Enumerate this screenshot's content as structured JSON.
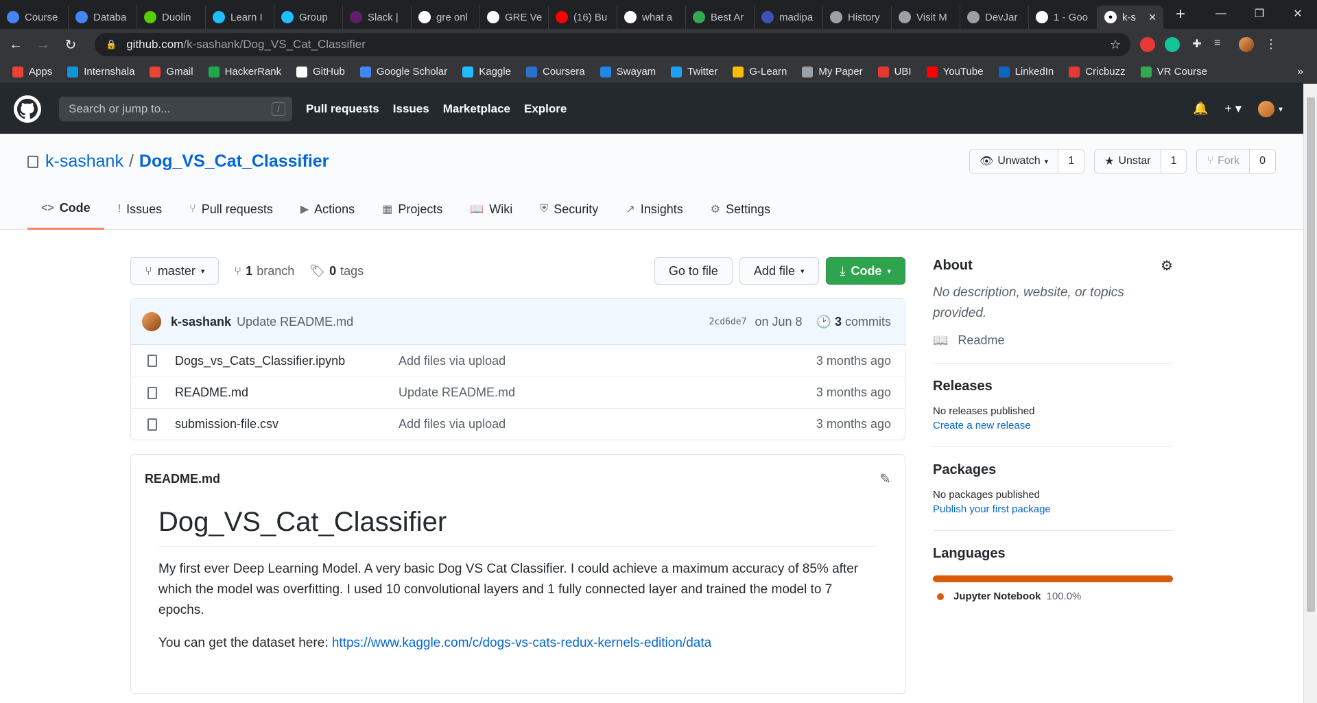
{
  "browser": {
    "tabs": [
      {
        "label": "Course",
        "icon_color": "#4285f4"
      },
      {
        "label": "Databa",
        "icon_color": "#4285f4"
      },
      {
        "label": "Duolin",
        "icon_color": "#58cc02"
      },
      {
        "label": "Learn I",
        "icon_color": "#20beff"
      },
      {
        "label": "Group",
        "icon_color": "#20beff"
      },
      {
        "label": "Slack |",
        "icon_color": "#611f69"
      },
      {
        "label": "gre onl",
        "icon_color": "#ffffff"
      },
      {
        "label": "GRE Ve",
        "icon_color": "#ffffff"
      },
      {
        "label": "(16) Bu",
        "icon_color": "#ff0000"
      },
      {
        "label": "what a",
        "icon_color": "#ffffff"
      },
      {
        "label": "Best Ar",
        "icon_color": "#34a853"
      },
      {
        "label": "madipa",
        "icon_color": "#3f51b5"
      },
      {
        "label": "History",
        "icon_color": "#9aa0a6"
      },
      {
        "label": "Visit M",
        "icon_color": "#9aa0a6"
      },
      {
        "label": "DevJar",
        "icon_color": "#9aa0a6"
      },
      {
        "label": "1 - Goo",
        "icon_color": "#ffffff"
      }
    ],
    "active_tab": {
      "label": "k-s"
    },
    "url_host": "github.com",
    "url_path": "/k-sashank/Dog_VS_Cat_Classifier",
    "bookmarks": [
      {
        "label": "Apps",
        "color": "#ea4335"
      },
      {
        "label": "Internshala",
        "color": "#1295d8"
      },
      {
        "label": "Gmail",
        "color": "#ea4335"
      },
      {
        "label": "HackerRank",
        "color": "#1ba94c"
      },
      {
        "label": "GitHub",
        "color": "#ffffff"
      },
      {
        "label": "Google Scholar",
        "color": "#4285f4"
      },
      {
        "label": "Kaggle",
        "color": "#20beff"
      },
      {
        "label": "Coursera",
        "color": "#2a73cc"
      },
      {
        "label": "Swayam",
        "color": "#1e88e5"
      },
      {
        "label": "Twitter",
        "color": "#1da1f2"
      },
      {
        "label": "G-Learn",
        "color": "#fbbc05"
      },
      {
        "label": "My Paper",
        "color": "#9aa0a6"
      },
      {
        "label": "UBI",
        "color": "#e53935"
      },
      {
        "label": "YouTube",
        "color": "#ff0000"
      },
      {
        "label": "LinkedIn",
        "color": "#0a66c2"
      },
      {
        "label": "Cricbuzz",
        "color": "#e53935"
      },
      {
        "label": "VR Course",
        "color": "#34a853"
      }
    ],
    "bookmarks_more": "»"
  },
  "gh": {
    "search_placeholder": "Search or jump to...",
    "search_key": "/",
    "nav": [
      "Pull requests",
      "Issues",
      "Marketplace",
      "Explore"
    ]
  },
  "repo": {
    "owner": "k-sashank",
    "separator": "/",
    "name": "Dog_VS_Cat_Classifier",
    "watch_label": "Unwatch",
    "watch_count": "1",
    "star_label": "Unstar",
    "star_count": "1",
    "fork_label": "Fork",
    "fork_count": "0",
    "tabs": [
      {
        "label": "Code",
        "icon": "<>"
      },
      {
        "label": "Issues",
        "icon": "!"
      },
      {
        "label": "Pull requests",
        "icon": "⑂"
      },
      {
        "label": "Actions",
        "icon": "▶"
      },
      {
        "label": "Projects",
        "icon": "▦"
      },
      {
        "label": "Wiki",
        "icon": "📖"
      },
      {
        "label": "Security",
        "icon": "⛨"
      },
      {
        "label": "Insights",
        "icon": "↗"
      },
      {
        "label": "Settings",
        "icon": "⚙"
      }
    ]
  },
  "toolbar": {
    "branch": "master",
    "branch_count": "1",
    "branch_word": "branch",
    "tag_count": "0",
    "tag_word": "tags",
    "go_to_file": "Go to file",
    "add_file": "Add file",
    "code": "Code"
  },
  "commit": {
    "user": "k-sashank",
    "message": "Update README.md",
    "sha": "2cd6de7",
    "when": "on Jun 8",
    "count": "3",
    "count_word": "commits"
  },
  "files": [
    {
      "name": "Dogs_vs_Cats_Classifier.ipynb",
      "message": "Add files via upload",
      "age": "3 months ago"
    },
    {
      "name": "README.md",
      "message": "Update README.md",
      "age": "3 months ago"
    },
    {
      "name": "submission-file.csv",
      "message": "Add files via upload",
      "age": "3 months ago"
    }
  ],
  "readme": {
    "filename": "README.md",
    "title": "Dog_VS_Cat_Classifier",
    "paragraph": "My first ever Deep Learning Model. A very basic Dog VS Cat Classifier. I could achieve a maximum accuracy of 85% after which the model was overfitting. I used 10 convolutional layers and 1 fully connected layer and trained the model to 7 epochs.",
    "dataset_prefix": "You can get the dataset here: ",
    "dataset_link": "https://www.kaggle.com/c/dogs-vs-cats-redux-kernels-edition/data"
  },
  "sidebar": {
    "about_title": "About",
    "about_text": "No description, website, or topics provided.",
    "readme_link": "Readme",
    "releases_title": "Releases",
    "releases_none": "No releases published",
    "releases_create": "Create a new release",
    "packages_title": "Packages",
    "packages_none": "No packages published",
    "packages_publish": "Publish your first package",
    "languages_title": "Languages",
    "language_name": "Jupyter Notebook",
    "language_pct": "100.0%",
    "language_color": "#DA5B0B"
  }
}
